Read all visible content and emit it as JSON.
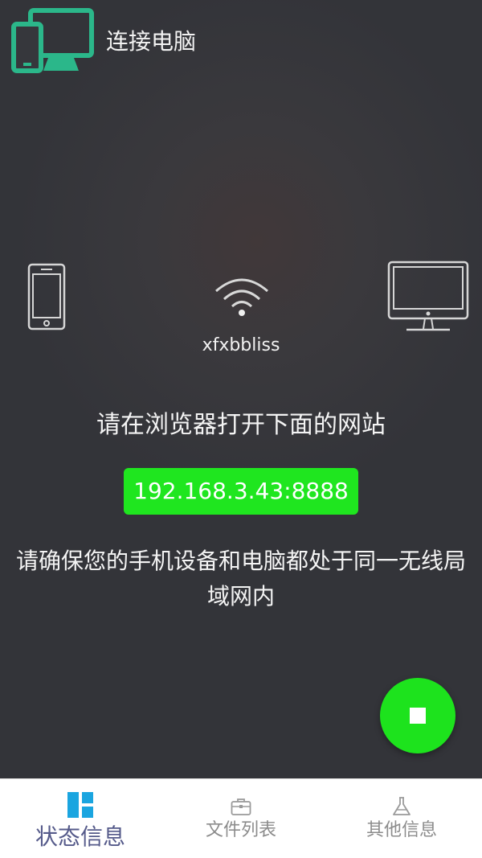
{
  "header": {
    "title": "连接电脑",
    "icon": "devices-icon",
    "accent_color": "#2bb78a"
  },
  "connection": {
    "ssid": "xfxbbliss",
    "instruction": "请在浏览器打开下面的网站",
    "url": "192.168.3.43:8888",
    "url_bg_color": "#1fe61f",
    "note": "请确保您的手机设备和电脑都处于同一无线局域网内"
  },
  "fab": {
    "icon": "stop-icon",
    "color": "#1de31d"
  },
  "bottom_nav": {
    "items": [
      {
        "label": "状态信息",
        "icon": "dashboard-icon",
        "active": true,
        "color": "#1aa5e0"
      },
      {
        "label": "文件列表",
        "icon": "briefcase-icon",
        "active": false
      },
      {
        "label": "其他信息",
        "icon": "flask-icon",
        "active": false
      }
    ]
  }
}
